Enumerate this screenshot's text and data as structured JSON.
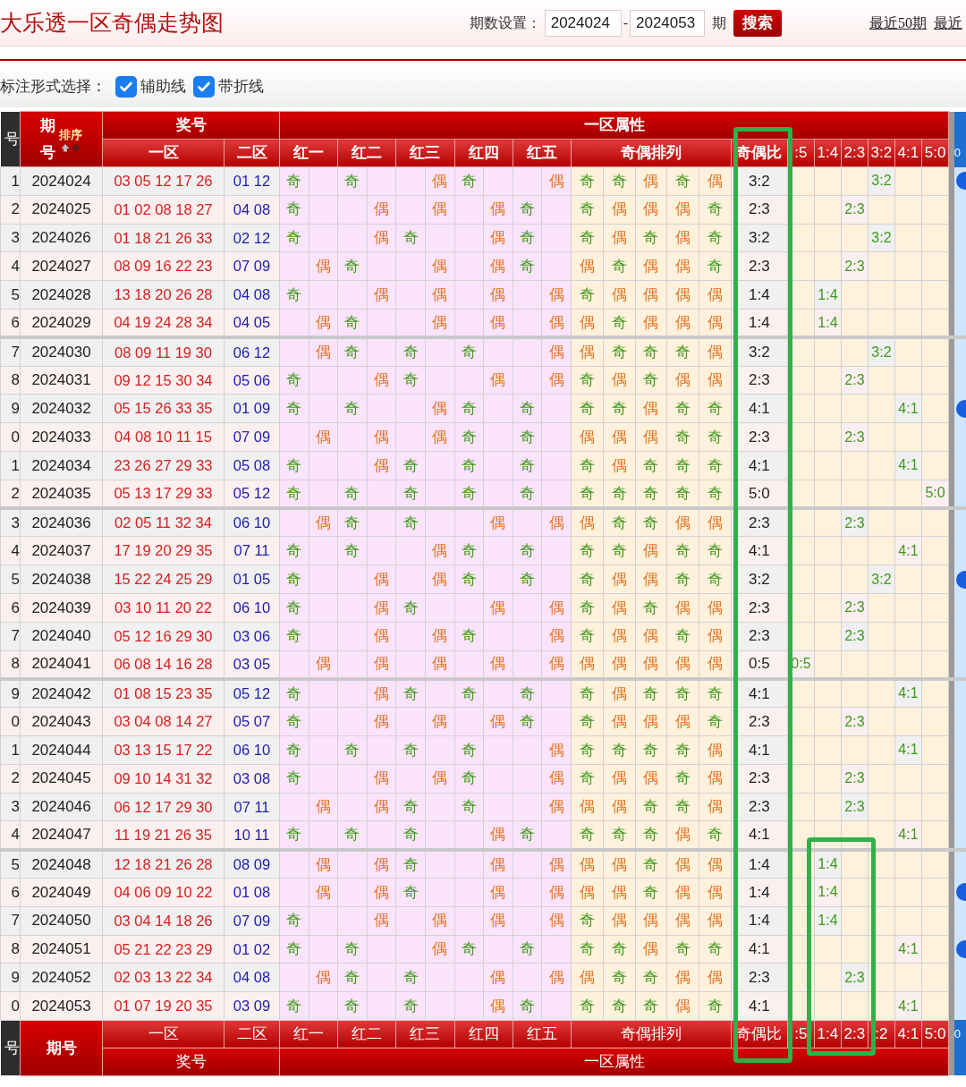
{
  "header": {
    "title": "大乐透一区奇偶走势图",
    "period_label": "期数设置：",
    "start": "2024024",
    "separator": "-",
    "end": "2024053",
    "unit": "期",
    "search_button": "搜索",
    "links": [
      "最近50期",
      "最近"
    ]
  },
  "options": {
    "label": "标注形式选择：",
    "items": [
      {
        "label": "辅助线",
        "checked": true
      },
      {
        "label": "带折线",
        "checked": true
      }
    ]
  },
  "table": {
    "head": {
      "index": "号",
      "period": "期号",
      "sort": "排序",
      "prize": "奖号",
      "attr": "一区属性",
      "zone1": "一区",
      "zone2": "二区",
      "reds": [
        "红一",
        "红二",
        "红三",
        "红四",
        "红五"
      ],
      "pattern": "奇偶排列",
      "ratio": "奇偶比",
      "dists": [
        ":5",
        "1:4",
        "2:3",
        "3:2",
        "4:1",
        "5:0"
      ],
      "extra": "0"
    },
    "rows": [
      {
        "no": "1",
        "period": "2024024",
        "red": "03 05 12 17 26",
        "blue": "01 12",
        "odd": [
          true,
          true,
          false,
          true,
          false
        ],
        "marks": [
          "奇",
          "奇",
          "偶",
          "奇",
          "偶"
        ],
        "pattern_odd": [
          true,
          true,
          false,
          true,
          false
        ],
        "pattern": [
          "奇",
          "奇",
          "偶",
          "奇",
          "偶"
        ],
        "ratio": "3:2",
        "dist_selected": [
          false,
          false,
          false,
          true,
          false,
          false
        ],
        "dist": "3:2",
        "dot": true
      },
      {
        "no": "2",
        "period": "2024025",
        "red": "01 02 08 18 27",
        "blue": "04 08",
        "odd": [
          true,
          false,
          false,
          false,
          true
        ],
        "marks": [
          "奇",
          "偶",
          "偶",
          "偶",
          "奇"
        ],
        "pattern_odd": [
          true,
          false,
          false,
          false,
          true
        ],
        "pattern": [
          "奇",
          "偶",
          "偶",
          "偶",
          "奇"
        ],
        "ratio": "2:3",
        "dist_selected": [
          false,
          false,
          true,
          false,
          false,
          false
        ],
        "dist": "2:3",
        "dot": false
      },
      {
        "no": "3",
        "period": "2024026",
        "red": "01 18 21 26 33",
        "blue": "02 12",
        "odd": [
          true,
          false,
          true,
          false,
          true
        ],
        "marks": [
          "奇",
          "偶",
          "奇",
          "偶",
          "奇"
        ],
        "pattern_odd": [
          true,
          false,
          true,
          false,
          true
        ],
        "pattern": [
          "奇",
          "偶",
          "奇",
          "偶",
          "奇"
        ],
        "ratio": "3:2",
        "dist_selected": [
          false,
          false,
          false,
          true,
          false,
          false
        ],
        "dist": "3:2",
        "dot": false
      },
      {
        "no": "4",
        "period": "2024027",
        "red": "08 09 16 22 23",
        "blue": "07 09",
        "odd": [
          false,
          true,
          false,
          false,
          true
        ],
        "marks": [
          "偶",
          "奇",
          "偶",
          "偶",
          "奇"
        ],
        "pattern_odd": [
          false,
          true,
          false,
          false,
          true
        ],
        "pattern": [
          "偶",
          "奇",
          "偶",
          "偶",
          "奇"
        ],
        "ratio": "2:3",
        "dist_selected": [
          false,
          false,
          true,
          false,
          false,
          false
        ],
        "dist": "2:3",
        "dot": false
      },
      {
        "no": "5",
        "period": "2024028",
        "red": "13 18 20 26 28",
        "blue": "04 08",
        "odd": [
          true,
          false,
          false,
          false,
          false
        ],
        "marks": [
          "奇",
          "偶",
          "偶",
          "偶",
          "偶"
        ],
        "pattern_odd": [
          true,
          false,
          false,
          false,
          false
        ],
        "pattern": [
          "奇",
          "偶",
          "偶",
          "偶",
          "偶"
        ],
        "ratio": "1:4",
        "dist_selected": [
          false,
          true,
          false,
          false,
          false,
          false
        ],
        "dist": "1:4",
        "dot": false
      },
      {
        "no": "6",
        "period": "2024029",
        "red": "04 19 24 28 34",
        "blue": "04 05",
        "odd": [
          false,
          true,
          false,
          false,
          false
        ],
        "marks": [
          "偶",
          "奇",
          "偶",
          "偶",
          "偶"
        ],
        "pattern_odd": [
          false,
          true,
          false,
          false,
          false
        ],
        "pattern": [
          "偶",
          "奇",
          "偶",
          "偶",
          "偶"
        ],
        "ratio": "1:4",
        "dist_selected": [
          false,
          true,
          false,
          false,
          false,
          false
        ],
        "dist": "1:4",
        "dot": false
      },
      {
        "no": "7",
        "period": "2024030",
        "red": "08 09 11 19 30",
        "blue": "06 12",
        "odd": [
          false,
          true,
          true,
          true,
          false
        ],
        "marks": [
          "偶",
          "奇",
          "奇",
          "奇",
          "偶"
        ],
        "pattern_odd": [
          false,
          true,
          true,
          true,
          false
        ],
        "pattern": [
          "偶",
          "奇",
          "奇",
          "奇",
          "偶"
        ],
        "ratio": "3:2",
        "dist_selected": [
          false,
          false,
          false,
          true,
          false,
          false
        ],
        "dist": "3:2",
        "dot": false
      },
      {
        "no": "8",
        "period": "2024031",
        "red": "09 12 15 30 34",
        "blue": "05 06",
        "odd": [
          true,
          false,
          true,
          false,
          false
        ],
        "marks": [
          "奇",
          "偶",
          "奇",
          "偶",
          "偶"
        ],
        "pattern_odd": [
          true,
          false,
          true,
          false,
          false
        ],
        "pattern": [
          "奇",
          "偶",
          "奇",
          "偶",
          "偶"
        ],
        "ratio": "2:3",
        "dist_selected": [
          false,
          false,
          true,
          false,
          false,
          false
        ],
        "dist": "2:3",
        "dot": false
      },
      {
        "no": "9",
        "period": "2024032",
        "red": "05 15 26 33 35",
        "blue": "01 09",
        "odd": [
          true,
          true,
          false,
          true,
          true
        ],
        "marks": [
          "奇",
          "奇",
          "偶",
          "奇",
          "奇"
        ],
        "pattern_odd": [
          true,
          true,
          false,
          true,
          true
        ],
        "pattern": [
          "奇",
          "奇",
          "偶",
          "奇",
          "奇"
        ],
        "ratio": "4:1",
        "dist_selected": [
          false,
          false,
          false,
          false,
          true,
          false
        ],
        "dist": "4:1",
        "dot": true
      },
      {
        "no": "0",
        "period": "2024033",
        "red": "04 08 10 11 15",
        "blue": "07 09",
        "odd": [
          false,
          false,
          false,
          true,
          true
        ],
        "marks": [
          "偶",
          "偶",
          "偶",
          "奇",
          "奇"
        ],
        "pattern_odd": [
          false,
          false,
          false,
          true,
          true
        ],
        "pattern": [
          "偶",
          "偶",
          "偶",
          "奇",
          "奇"
        ],
        "ratio": "2:3",
        "dist_selected": [
          false,
          false,
          true,
          false,
          false,
          false
        ],
        "dist": "2:3",
        "dot": false
      },
      {
        "no": "1",
        "period": "2024034",
        "red": "23 26 27 29 33",
        "blue": "05 08",
        "odd": [
          true,
          false,
          true,
          true,
          true
        ],
        "marks": [
          "奇",
          "偶",
          "奇",
          "奇",
          "奇"
        ],
        "pattern_odd": [
          true,
          false,
          true,
          true,
          true
        ],
        "pattern": [
          "奇",
          "偶",
          "奇",
          "奇",
          "奇"
        ],
        "ratio": "4:1",
        "dist_selected": [
          false,
          false,
          false,
          false,
          true,
          false
        ],
        "dist": "4:1",
        "dot": false
      },
      {
        "no": "2",
        "period": "2024035",
        "red": "05 13 17 29 33",
        "blue": "05 12",
        "odd": [
          true,
          true,
          true,
          true,
          true
        ],
        "marks": [
          "奇",
          "奇",
          "奇",
          "奇",
          "奇"
        ],
        "pattern_odd": [
          true,
          true,
          true,
          true,
          true
        ],
        "pattern": [
          "奇",
          "奇",
          "奇",
          "奇",
          "奇"
        ],
        "ratio": "5:0",
        "dist_selected": [
          false,
          false,
          false,
          false,
          false,
          true
        ],
        "dist": "5:0",
        "dot": false
      },
      {
        "no": "3",
        "period": "2024036",
        "red": "02 05 11 32 34",
        "blue": "06 10",
        "odd": [
          false,
          true,
          true,
          false,
          false
        ],
        "marks": [
          "偶",
          "奇",
          "奇",
          "偶",
          "偶"
        ],
        "pattern_odd": [
          false,
          true,
          true,
          false,
          false
        ],
        "pattern": [
          "偶",
          "奇",
          "奇",
          "偶",
          "偶"
        ],
        "ratio": "2:3",
        "dist_selected": [
          false,
          false,
          true,
          false,
          false,
          false
        ],
        "dist": "2:3",
        "dot": false
      },
      {
        "no": "4",
        "period": "2024037",
        "red": "17 19 20 29 35",
        "blue": "07 11",
        "odd": [
          true,
          true,
          false,
          true,
          true
        ],
        "marks": [
          "奇",
          "奇",
          "偶",
          "奇",
          "奇"
        ],
        "pattern_odd": [
          true,
          true,
          false,
          true,
          true
        ],
        "pattern": [
          "奇",
          "奇",
          "偶",
          "奇",
          "奇"
        ],
        "ratio": "4:1",
        "dist_selected": [
          false,
          false,
          false,
          false,
          true,
          false
        ],
        "dist": "4:1",
        "dot": false
      },
      {
        "no": "5",
        "period": "2024038",
        "red": "15 22 24 25 29",
        "blue": "01 05",
        "odd": [
          true,
          false,
          false,
          true,
          true
        ],
        "marks": [
          "奇",
          "偶",
          "偶",
          "奇",
          "奇"
        ],
        "pattern_odd": [
          true,
          false,
          false,
          true,
          true
        ],
        "pattern": [
          "奇",
          "偶",
          "偶",
          "奇",
          "奇"
        ],
        "ratio": "3:2",
        "dist_selected": [
          false,
          false,
          false,
          true,
          false,
          false
        ],
        "dist": "3:2",
        "dot": true
      },
      {
        "no": "6",
        "period": "2024039",
        "red": "03 10 11 20 22",
        "blue": "06 10",
        "odd": [
          true,
          false,
          true,
          false,
          false
        ],
        "marks": [
          "奇",
          "偶",
          "奇",
          "偶",
          "偶"
        ],
        "pattern_odd": [
          true,
          false,
          true,
          false,
          false
        ],
        "pattern": [
          "奇",
          "偶",
          "奇",
          "偶",
          "偶"
        ],
        "ratio": "2:3",
        "dist_selected": [
          false,
          false,
          true,
          false,
          false,
          false
        ],
        "dist": "2:3",
        "dot": false
      },
      {
        "no": "7",
        "period": "2024040",
        "red": "05 12 16 29 30",
        "blue": "03 06",
        "odd": [
          true,
          false,
          false,
          true,
          false
        ],
        "marks": [
          "奇",
          "偶",
          "偶",
          "奇",
          "偶"
        ],
        "pattern_odd": [
          true,
          false,
          false,
          true,
          false
        ],
        "pattern": [
          "奇",
          "偶",
          "偶",
          "奇",
          "偶"
        ],
        "ratio": "2:3",
        "dist_selected": [
          false,
          false,
          true,
          false,
          false,
          false
        ],
        "dist": "2:3",
        "dot": false
      },
      {
        "no": "8",
        "period": "2024041",
        "red": "06 08 14 16 28",
        "blue": "03 05",
        "odd": [
          false,
          false,
          false,
          false,
          false
        ],
        "marks": [
          "偶",
          "偶",
          "偶",
          "偶",
          "偶"
        ],
        "pattern_odd": [
          false,
          false,
          false,
          false,
          false
        ],
        "pattern": [
          "偶",
          "偶",
          "偶",
          "偶",
          "偶"
        ],
        "ratio": "0:5",
        "dist_selected": [
          true,
          false,
          false,
          false,
          false,
          false
        ],
        "dist": "0:5",
        "dot": false
      },
      {
        "no": "9",
        "period": "2024042",
        "red": "01 08 15 23 35",
        "blue": "05 12",
        "odd": [
          true,
          false,
          true,
          true,
          true
        ],
        "marks": [
          "奇",
          "偶",
          "奇",
          "奇",
          "奇"
        ],
        "pattern_odd": [
          true,
          false,
          true,
          true,
          true
        ],
        "pattern": [
          "奇",
          "偶",
          "奇",
          "奇",
          "奇"
        ],
        "ratio": "4:1",
        "dist_selected": [
          false,
          false,
          false,
          false,
          true,
          false
        ],
        "dist": "4:1",
        "dot": false
      },
      {
        "no": "0",
        "period": "2024043",
        "red": "03 04 08 14 27",
        "blue": "05 07",
        "odd": [
          true,
          false,
          false,
          false,
          true
        ],
        "marks": [
          "奇",
          "偶",
          "偶",
          "偶",
          "奇"
        ],
        "pattern_odd": [
          true,
          false,
          false,
          false,
          true
        ],
        "pattern": [
          "奇",
          "偶",
          "偶",
          "偶",
          "奇"
        ],
        "ratio": "2:3",
        "dist_selected": [
          false,
          false,
          true,
          false,
          false,
          false
        ],
        "dist": "2:3",
        "dot": false
      },
      {
        "no": "1",
        "period": "2024044",
        "red": "03 13 15 17 22",
        "blue": "06 10",
        "odd": [
          true,
          true,
          true,
          true,
          false
        ],
        "marks": [
          "奇",
          "奇",
          "奇",
          "奇",
          "偶"
        ],
        "pattern_odd": [
          true,
          true,
          true,
          true,
          false
        ],
        "pattern": [
          "奇",
          "奇",
          "奇",
          "奇",
          "偶"
        ],
        "ratio": "4:1",
        "dist_selected": [
          false,
          false,
          false,
          false,
          true,
          false
        ],
        "dist": "4:1",
        "dot": false
      },
      {
        "no": "2",
        "period": "2024045",
        "red": "09 10 14 31 32",
        "blue": "03 08",
        "odd": [
          true,
          false,
          false,
          true,
          false
        ],
        "marks": [
          "奇",
          "偶",
          "偶",
          "奇",
          "偶"
        ],
        "pattern_odd": [
          true,
          false,
          false,
          true,
          false
        ],
        "pattern": [
          "奇",
          "偶",
          "偶",
          "奇",
          "偶"
        ],
        "ratio": "2:3",
        "dist_selected": [
          false,
          false,
          true,
          false,
          false,
          false
        ],
        "dist": "2:3",
        "dot": false
      },
      {
        "no": "3",
        "period": "2024046",
        "red": "06 12 17 29 30",
        "blue": "07 11",
        "odd": [
          false,
          false,
          true,
          true,
          false
        ],
        "marks": [
          "偶",
          "偶",
          "奇",
          "奇",
          "偶"
        ],
        "pattern_odd": [
          false,
          false,
          true,
          true,
          false
        ],
        "pattern": [
          "偶",
          "偶",
          "奇",
          "奇",
          "偶"
        ],
        "ratio": "2:3",
        "dist_selected": [
          false,
          false,
          true,
          false,
          false,
          false
        ],
        "dist": "2:3",
        "dot": false
      },
      {
        "no": "4",
        "period": "2024047",
        "red": "11 19 21 26 35",
        "blue": "10 11",
        "odd": [
          true,
          true,
          true,
          false,
          true
        ],
        "marks": [
          "奇",
          "奇",
          "奇",
          "偶",
          "奇"
        ],
        "pattern_odd": [
          true,
          true,
          true,
          false,
          true
        ],
        "pattern": [
          "奇",
          "奇",
          "奇",
          "偶",
          "奇"
        ],
        "ratio": "4:1",
        "dist_selected": [
          false,
          false,
          false,
          false,
          true,
          false
        ],
        "dist": "4:1",
        "dot": false
      },
      {
        "no": "5",
        "period": "2024048",
        "red": "12 18 21 26 28",
        "blue": "08 09",
        "odd": [
          false,
          false,
          true,
          false,
          false
        ],
        "marks": [
          "偶",
          "偶",
          "奇",
          "偶",
          "偶"
        ],
        "pattern_odd": [
          false,
          false,
          true,
          false,
          false
        ],
        "pattern": [
          "偶",
          "偶",
          "奇",
          "偶",
          "偶"
        ],
        "ratio": "1:4",
        "dist_selected": [
          false,
          true,
          false,
          false,
          false,
          false
        ],
        "dist": "1:4",
        "dot": false
      },
      {
        "no": "6",
        "period": "2024049",
        "red": "04 06 09 10 22",
        "blue": "01 08",
        "odd": [
          false,
          false,
          true,
          false,
          false
        ],
        "marks": [
          "偶",
          "偶",
          "奇",
          "偶",
          "偶"
        ],
        "pattern_odd": [
          false,
          false,
          true,
          false,
          false
        ],
        "pattern": [
          "偶",
          "偶",
          "奇",
          "偶",
          "偶"
        ],
        "ratio": "1:4",
        "dist_selected": [
          false,
          true,
          false,
          false,
          false,
          false
        ],
        "dist": "1:4",
        "dot": true
      },
      {
        "no": "7",
        "period": "2024050",
        "red": "03 04 14 18 26",
        "blue": "07 09",
        "odd": [
          true,
          false,
          false,
          false,
          false
        ],
        "marks": [
          "奇",
          "偶",
          "偶",
          "偶",
          "偶"
        ],
        "pattern_odd": [
          true,
          false,
          false,
          false,
          false
        ],
        "pattern": [
          "奇",
          "偶",
          "偶",
          "偶",
          "偶"
        ],
        "ratio": "1:4",
        "dist_selected": [
          false,
          true,
          false,
          false,
          false,
          false
        ],
        "dist": "1:4",
        "dot": false
      },
      {
        "no": "8",
        "period": "2024051",
        "red": "05 21 22 23 29",
        "blue": "01 02",
        "odd": [
          true,
          true,
          false,
          true,
          true
        ],
        "marks": [
          "奇",
          "奇",
          "偶",
          "奇",
          "奇"
        ],
        "pattern_odd": [
          true,
          true,
          false,
          true,
          true
        ],
        "pattern": [
          "奇",
          "奇",
          "偶",
          "奇",
          "奇"
        ],
        "ratio": "4:1",
        "dist_selected": [
          false,
          false,
          false,
          false,
          true,
          false
        ],
        "dist": "4:1",
        "dot": true
      },
      {
        "no": "9",
        "period": "2024052",
        "red": "02 03 13 22 34",
        "blue": "04 08",
        "odd": [
          false,
          true,
          true,
          false,
          false
        ],
        "marks": [
          "偶",
          "奇",
          "奇",
          "偶",
          "偶"
        ],
        "pattern_odd": [
          false,
          true,
          true,
          false,
          false
        ],
        "pattern": [
          "偶",
          "奇",
          "奇",
          "偶",
          "偶"
        ],
        "ratio": "2:3",
        "dist_selected": [
          false,
          false,
          true,
          false,
          false,
          false
        ],
        "dist": "2:3",
        "dot": false
      },
      {
        "no": "0",
        "period": "2024053",
        "red": "01 07 19 20 35",
        "blue": "03 09",
        "odd": [
          true,
          true,
          true,
          false,
          true
        ],
        "marks": [
          "奇",
          "奇",
          "奇",
          "偶",
          "奇"
        ],
        "pattern_odd": [
          true,
          true,
          true,
          false,
          true
        ],
        "pattern": [
          "奇",
          "奇",
          "奇",
          "偶",
          "奇"
        ],
        "ratio": "4:1",
        "dist_selected": [
          false,
          false,
          false,
          false,
          true,
          false
        ],
        "dist": "4:1",
        "dot": false
      }
    ],
    "foot": {
      "index": "号",
      "period": "期号",
      "zone1": "一区",
      "zone2": "二区",
      "reds": [
        "红一",
        "红二",
        "红三",
        "红四",
        "红五"
      ],
      "pattern": "奇偶排列",
      "ratio": "奇偶比",
      "dists": [
        ":5",
        "1:4",
        "2:3",
        ":2",
        "4:1",
        "5:0"
      ],
      "extra": "0",
      "prize": "奖号",
      "attr": "一区属性"
    }
  }
}
